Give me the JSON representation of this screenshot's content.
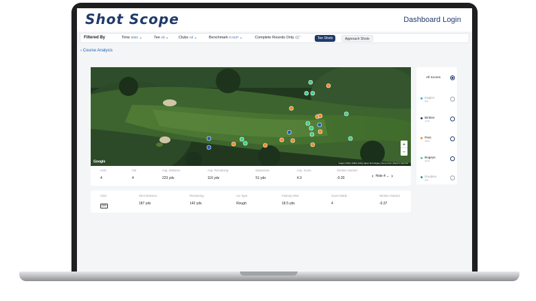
{
  "app": {
    "logo": "Shot Scope",
    "login_link": "Dashboard Login"
  },
  "filters": {
    "title": "Filtered By",
    "time_label": "Time",
    "time_value": "2022",
    "tee_label": "Tee",
    "tee_value": "All",
    "clubs_label": "Clubs",
    "clubs_value": "All",
    "benchmark_label": "Benchmark",
    "benchmark_value": "0 HCP",
    "complete_rounds_label": "Complete Rounds Only",
    "tab_tee": "Tee Shots",
    "tab_approach": "Approach Shots"
  },
  "breadcrumb": {
    "back_label": "Course Analysis"
  },
  "map": {
    "google_label": "Google",
    "attribution": "Imagery ©2022, CNES / Airbus, Maxar Technologies | Terms of Use | Report a map error",
    "zoom_in": "+",
    "zoom_out": "−",
    "colors": {
      "eagles": "#2aa9e0",
      "birdies": "#1f5fae",
      "pars": "#f08a24",
      "bogeys": "#3ecf8e",
      "doubles": "#1a9e6a"
    }
  },
  "stats": {
    "hole_label": "Hole",
    "hole_value": "4",
    "par_label": "Par",
    "par_value": "4",
    "avg_distance_label": "Avg. Distance",
    "avg_distance_value": "223 yds",
    "avg_remaining_label": "Avg. Remaining",
    "avg_remaining_value": "116 yds",
    "dispersion_label": "Dispersion",
    "dispersion_value": "51 yds",
    "avg_score_label": "Avg. Score",
    "avg_score_value": "4.3",
    "strokes_gained_label": "Strokes Gained",
    "strokes_gained_value": "-0.20",
    "hole_nav_label": "Hole 4"
  },
  "shot": {
    "club_label": "Club",
    "club_value": "DRV",
    "shot_distance_label": "Shot Distance",
    "shot_distance_value": "187 yds",
    "remaining_label": "Remaining",
    "remaining_value": "142 yds",
    "lie_type_label": "Lie Type",
    "lie_type_value": "Rough",
    "fairway_miss_label": "Fairway Miss",
    "fairway_miss_value": "18.5 yds",
    "score_made_label": "Score Made",
    "score_made_value": "4",
    "strokes_gained_label": "Strokes Gained",
    "strokes_gained_value": "-0.37"
  },
  "legend": {
    "all_scores": "All Scores",
    "eagles": "Eagles",
    "eagles_pct": "0%",
    "birdies": "Birdies",
    "birdies_pct": "17%",
    "pars": "Pars",
    "pars_pct": "40%",
    "bogeys": "Bogeys",
    "bogeys_pct": "42%",
    "doubles": "Doubles",
    "doubles_pct": "0%"
  }
}
